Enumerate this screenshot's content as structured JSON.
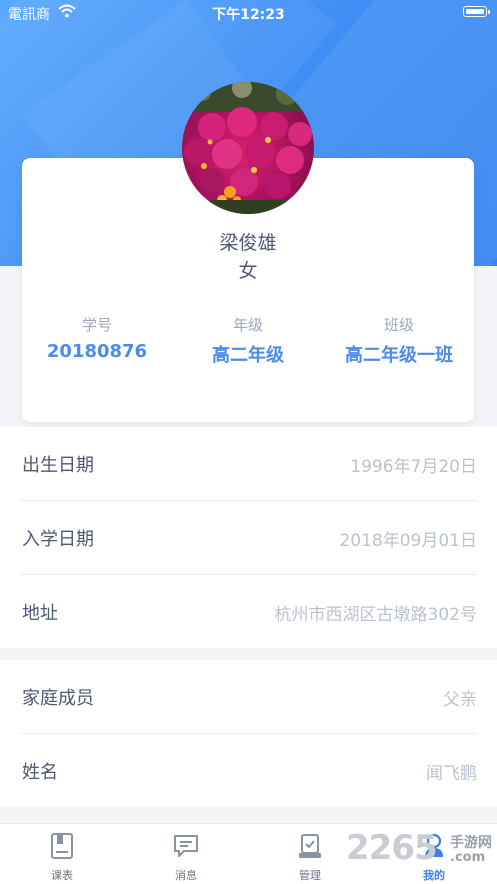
{
  "status_bar": {
    "carrier": "電訊商",
    "time": "下午12:23"
  },
  "profile": {
    "name": "梁俊雄",
    "gender": "女",
    "stats": [
      {
        "label": "学号",
        "value": "20180876"
      },
      {
        "label": "年级",
        "value": "高二年级"
      },
      {
        "label": "班级",
        "value": "高二年级一班"
      }
    ]
  },
  "info": [
    {
      "label": "出生日期",
      "value": "1996年7月20日"
    },
    {
      "label": "入学日期",
      "value": "2018年09月01日"
    },
    {
      "label": "地址",
      "value": "杭州市西湖区古墩路302号"
    }
  ],
  "family": [
    {
      "label": "家庭成员",
      "value": "父亲"
    },
    {
      "label": "姓名",
      "value": "闻飞鹏"
    }
  ],
  "tabs": [
    {
      "label": "课表",
      "icon": "book-icon"
    },
    {
      "label": "消息",
      "icon": "chat-icon"
    },
    {
      "label": "管理",
      "icon": "clipboard-icon"
    },
    {
      "label": "我的",
      "icon": "user-icon"
    }
  ],
  "watermark": {
    "number": "2265",
    "line1": "手游网",
    "line2": ".com"
  },
  "colors": {
    "accent": "#3a7ee8",
    "hero": "#3f8ff5"
  }
}
